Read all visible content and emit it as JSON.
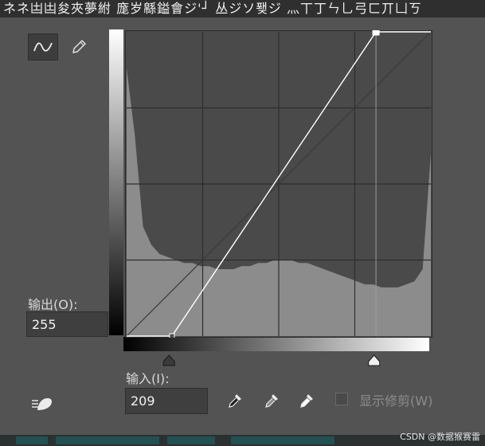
{
  "top_strip_text": "ネネ凷凷夋夾夢紨 庬岁緜鎰會ジ'┘ 丛ジソ퐺ジ 灬丅丁ㄣ乚弓ㄈ丌凵ㄎ",
  "toolbar": {
    "curve_tool_icon": "curve-icon",
    "pencil_tool_icon": "pencil-icon",
    "smooth_icon": "smooth-icon"
  },
  "output": {
    "label": "输出(O):",
    "value": "255"
  },
  "input": {
    "label": "输入(I):",
    "value": "209"
  },
  "eyedroppers": [
    {
      "name": "black-point-eyedropper",
      "icon": "eyedropper-black-icon"
    },
    {
      "name": "gray-point-eyedropper",
      "icon": "eyedropper-gray-icon"
    },
    {
      "name": "white-point-eyedropper",
      "icon": "eyedropper-white-icon"
    }
  ],
  "show_clipping": {
    "label": "显示修剪(W)",
    "checked": false
  },
  "curve": {
    "input_range": [
      0,
      255
    ],
    "output_range": [
      0,
      255
    ],
    "points": [
      {
        "input": 0,
        "output": 0
      },
      {
        "input": 38,
        "output": 0
      },
      {
        "input": 209,
        "output": 255
      },
      {
        "input": 255,
        "output": 255
      }
    ],
    "black_point_input": 38,
    "white_point_input": 209,
    "selected_point": {
      "input": 209,
      "output": 255
    }
  },
  "histogram_levels": [
    0.88,
    0.66,
    0.36,
    0.3,
    0.27,
    0.26,
    0.25,
    0.24,
    0.24,
    0.23,
    0.23,
    0.22,
    0.22,
    0.22,
    0.23,
    0.23,
    0.24,
    0.24,
    0.25,
    0.25,
    0.25,
    0.24,
    0.24,
    0.23,
    0.22,
    0.21,
    0.2,
    0.19,
    0.18,
    0.17,
    0.17,
    0.16,
    0.16,
    0.16,
    0.17,
    0.18,
    0.22,
    0.6
  ],
  "watermark": "CSDN @数据猴赛雷",
  "colors": {
    "panel_bg": "#535353",
    "graph_bg": "#4a4a4a",
    "histogram": "#8c8c8c",
    "grid": "#2e2e2e",
    "curve": "#ffffff"
  }
}
